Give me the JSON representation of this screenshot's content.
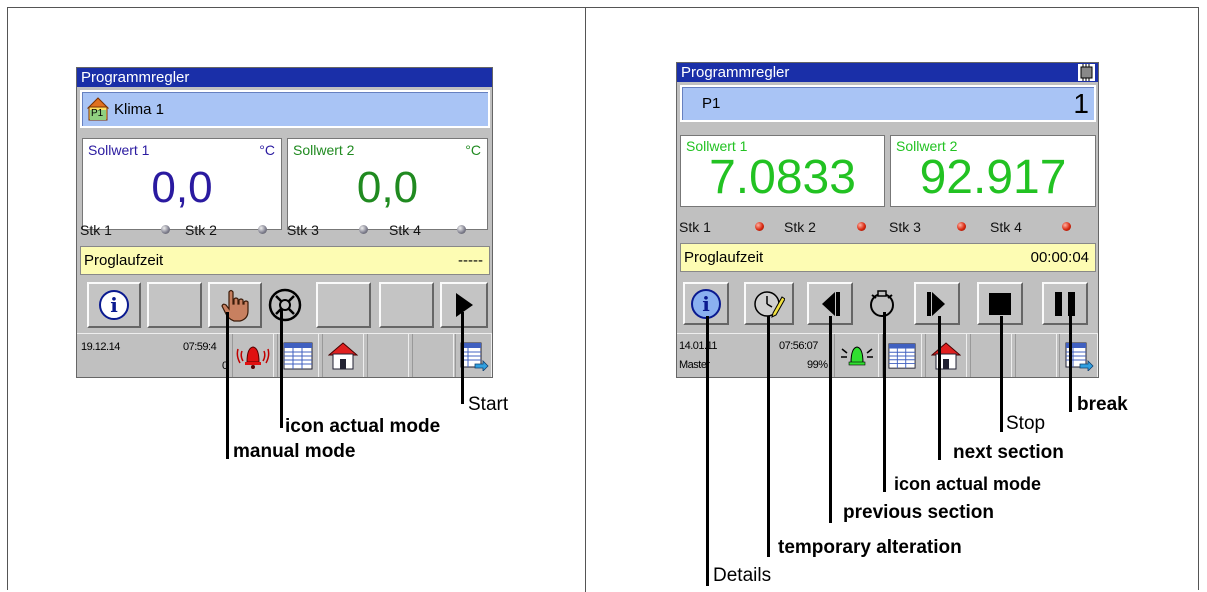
{
  "left": {
    "title": "Programmregler",
    "program_name": "Klima 1",
    "program_badge": "P1",
    "setpoints": [
      {
        "label": "Sollwert 1",
        "unit": "°C",
        "value": "0,0",
        "color": "#2a1aa0"
      },
      {
        "label": "Sollwert 2",
        "unit": "°C",
        "value": "0,0",
        "color": "#208a20"
      }
    ],
    "stk": [
      "Stk 1",
      "Stk 2",
      "Stk 3",
      "Stk 4"
    ],
    "proglaufzeit_label": "Proglaufzeit",
    "proglaufzeit_value": "-----",
    "status": {
      "date": "19.12.14",
      "time": "07:59:4",
      "extra": "0"
    },
    "callouts": {
      "start": "Start",
      "icon_actual_mode": "icon actual mode",
      "manual_mode": "manual mode"
    }
  },
  "right": {
    "title": "Programmregler",
    "program_name": "P1",
    "program_number": "1",
    "setpoints": [
      {
        "label": "Sollwert 1",
        "value": "7.0833",
        "color": "#22c222"
      },
      {
        "label": "Sollwert 2",
        "value": "92.917",
        "color": "#22c222"
      }
    ],
    "stk": [
      "Stk 1",
      "Stk 2",
      "Stk 3",
      "Stk 4"
    ],
    "proglaufzeit_label": "Proglaufzeit",
    "proglaufzeit_value": "00:00:04",
    "status": {
      "date": "14.01.11",
      "user": "Master",
      "time": "07:56:07",
      "percent": "99%"
    },
    "callouts": {
      "break": "break",
      "stop": "Stop",
      "next_section": "next section",
      "icon_actual_mode": "icon actual mode",
      "previous_section": "previous section",
      "temporary_alteration": "temporary alteration",
      "details": "Details"
    }
  },
  "colors": {
    "titlebar": "#1a2fa8",
    "progbar": "#a9c4f5",
    "yellow": "#fdfcb3",
    "led_off": "grey",
    "led_on": "red"
  }
}
